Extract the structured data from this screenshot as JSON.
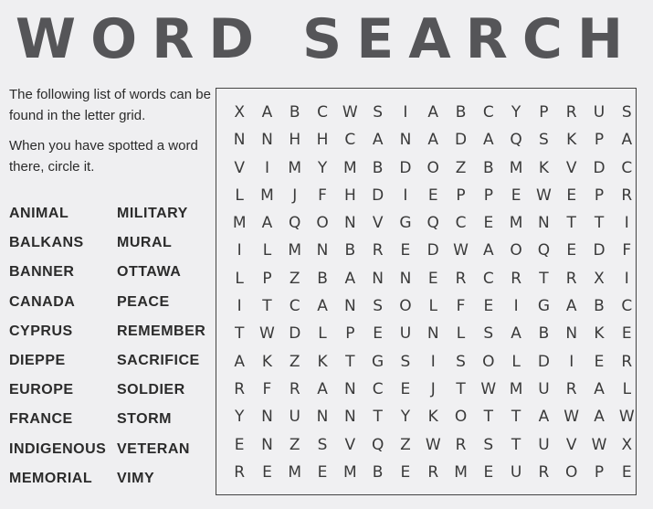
{
  "title": "WORD SEARCH",
  "instructions": {
    "line1": "The following list of words can be found in the letter grid.",
    "line2": "When you have spotted a word there, circle it."
  },
  "words": [
    "ANIMAL",
    "MILITARY",
    "BALKANS",
    "MURAL",
    "BANNER",
    "OTTAWA",
    "CANADA",
    "PEACE",
    "CYPRUS",
    "REMEMBER",
    "DIEPPE",
    "SACRIFICE",
    "EUROPE",
    "SOLDIER",
    "FRANCE",
    "STORM",
    "INDIGENOUS",
    "VETERAN",
    "MEMORIAL",
    "VIMY"
  ],
  "grid_rows": [
    "XABCWSIABCYPRUS",
    "NNHHCANADAQSKPA",
    "VIMYMBDOZBMKVDC",
    "LMJFHDIEPPEWEPR",
    "MAQONVGQCEMNTTI",
    "ILMNBREDWAOQEDF",
    "LPZBANNERCRTRXI",
    "ITCANSOLFEIGABC",
    "TWDLPEUNLSABNKE",
    "AKZKTGSISOLDIER",
    "RFRANCEJTWMURAL",
    "YNUNNTYKOTTAWAW",
    "ENZSVQZWRSTUVWX",
    "REMEMBERMEUROPE"
  ]
}
